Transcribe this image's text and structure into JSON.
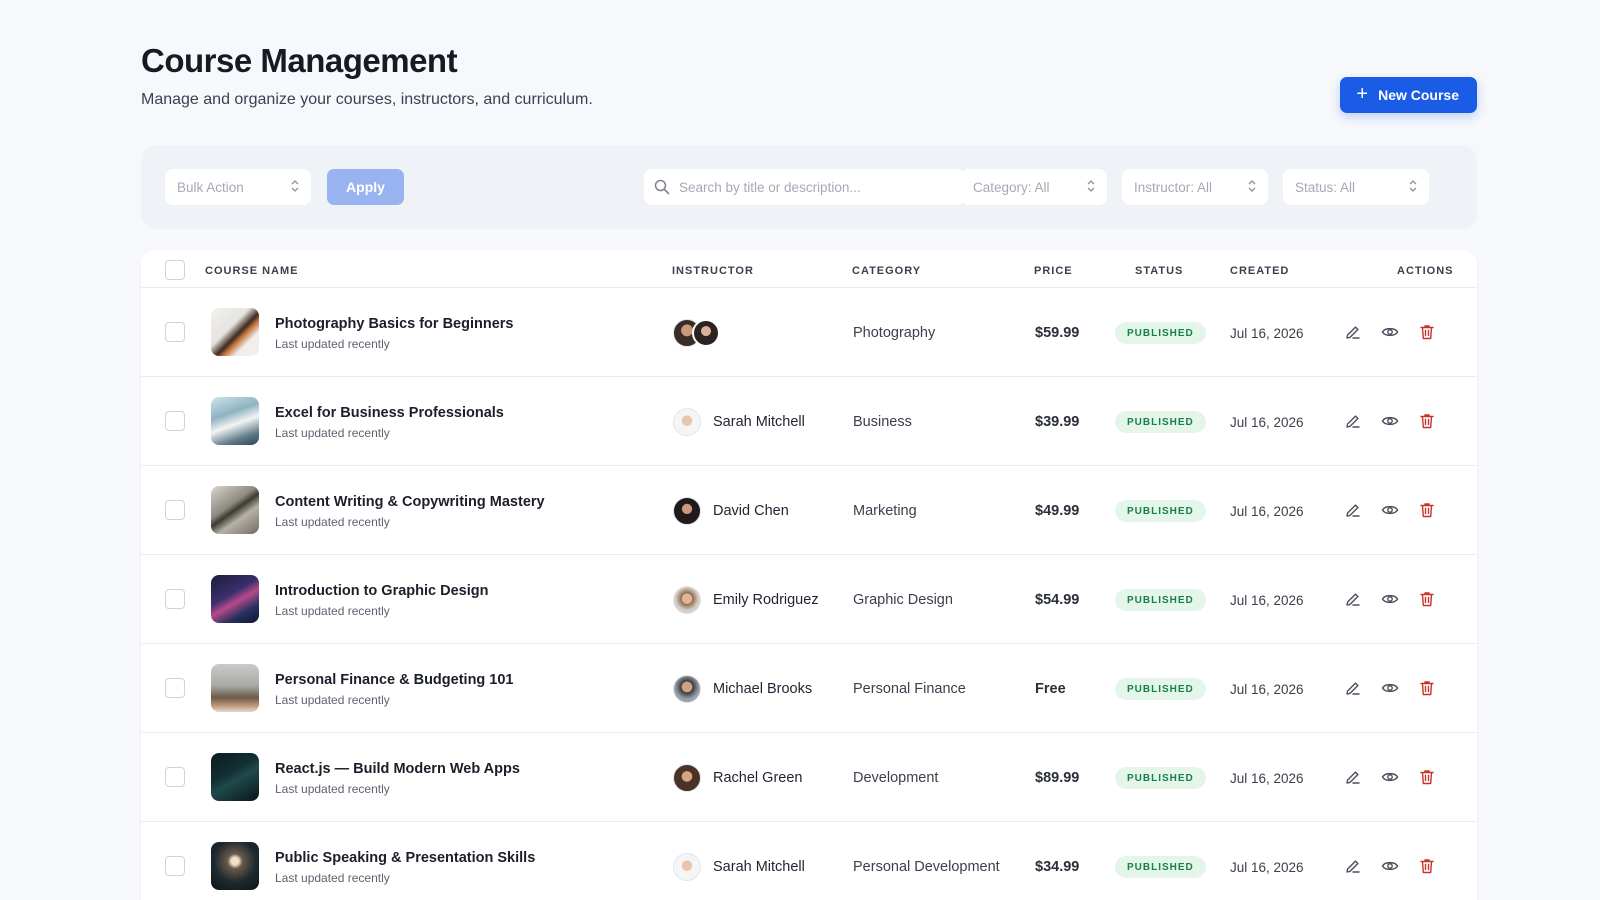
{
  "header": {
    "title": "Course Management",
    "subtitle": "Manage and organize your courses, instructors, and curriculum.",
    "new_course_label": "New Course"
  },
  "filters": {
    "bulk_action": "Bulk Action",
    "apply_label": "Apply",
    "search_placeholder": "Search by title or description...",
    "category": "Category: All",
    "instructor": "Instructor: All",
    "status": "Status: All"
  },
  "table": {
    "columns": {
      "course_name": "COURSE NAME",
      "instructor": "INSTRUCTOR",
      "category": "CATEGORY",
      "price": "PRICE",
      "status": "STATUS",
      "created": "CREATED",
      "actions": "ACTIONS"
    },
    "rows": [
      {
        "title": "Photography Basics for Beginners",
        "subtitle": "Last updated recently",
        "instructor": "",
        "category": "Photography",
        "price": "$59.99",
        "status": "PUBLISHED",
        "created": "Jul 16, 2026"
      },
      {
        "title": "Excel for Business Professionals",
        "subtitle": "Last updated recently",
        "instructor": "Sarah Mitchell",
        "category": "Business",
        "price": "$39.99",
        "status": "PUBLISHED",
        "created": "Jul 16, 2026"
      },
      {
        "title": "Content Writing & Copywriting Mastery",
        "subtitle": "Last updated recently",
        "instructor": "David Chen",
        "category": "Marketing",
        "price": "$49.99",
        "status": "PUBLISHED",
        "created": "Jul 16, 2026"
      },
      {
        "title": "Introduction to Graphic Design",
        "subtitle": "Last updated recently",
        "instructor": "Emily Rodriguez",
        "category": "Graphic Design",
        "price": "$54.99",
        "status": "PUBLISHED",
        "created": "Jul 16, 2026"
      },
      {
        "title": "Personal Finance & Budgeting 101",
        "subtitle": "Last updated recently",
        "instructor": "Michael Brooks",
        "category": "Personal Finance",
        "price": "Free",
        "status": "PUBLISHED",
        "created": "Jul 16, 2026"
      },
      {
        "title": "React.js — Build Modern Web Apps",
        "subtitle": "Last updated recently",
        "instructor": "Rachel Green",
        "category": "Development",
        "price": "$89.99",
        "status": "PUBLISHED",
        "created": "Jul 16, 2026"
      },
      {
        "title": "Public Speaking & Presentation Skills",
        "subtitle": "Last updated recently",
        "instructor": "Sarah Mitchell",
        "category": "Personal Development",
        "price": "$34.99",
        "status": "PUBLISHED",
        "created": "Jul 16, 2026"
      }
    ]
  },
  "icons": {
    "new": "plus-icon",
    "search": "search-icon",
    "select": "chevron-updown-icon",
    "edit": "edit-icon",
    "view": "eye-icon",
    "delete": "trash-icon"
  },
  "colors": {
    "primary": "#1a5ce6",
    "apply_disabled": "#98b3ef",
    "published_bg": "#e4f6ea",
    "published_text": "#18804a",
    "delete": "#c8322b"
  }
}
